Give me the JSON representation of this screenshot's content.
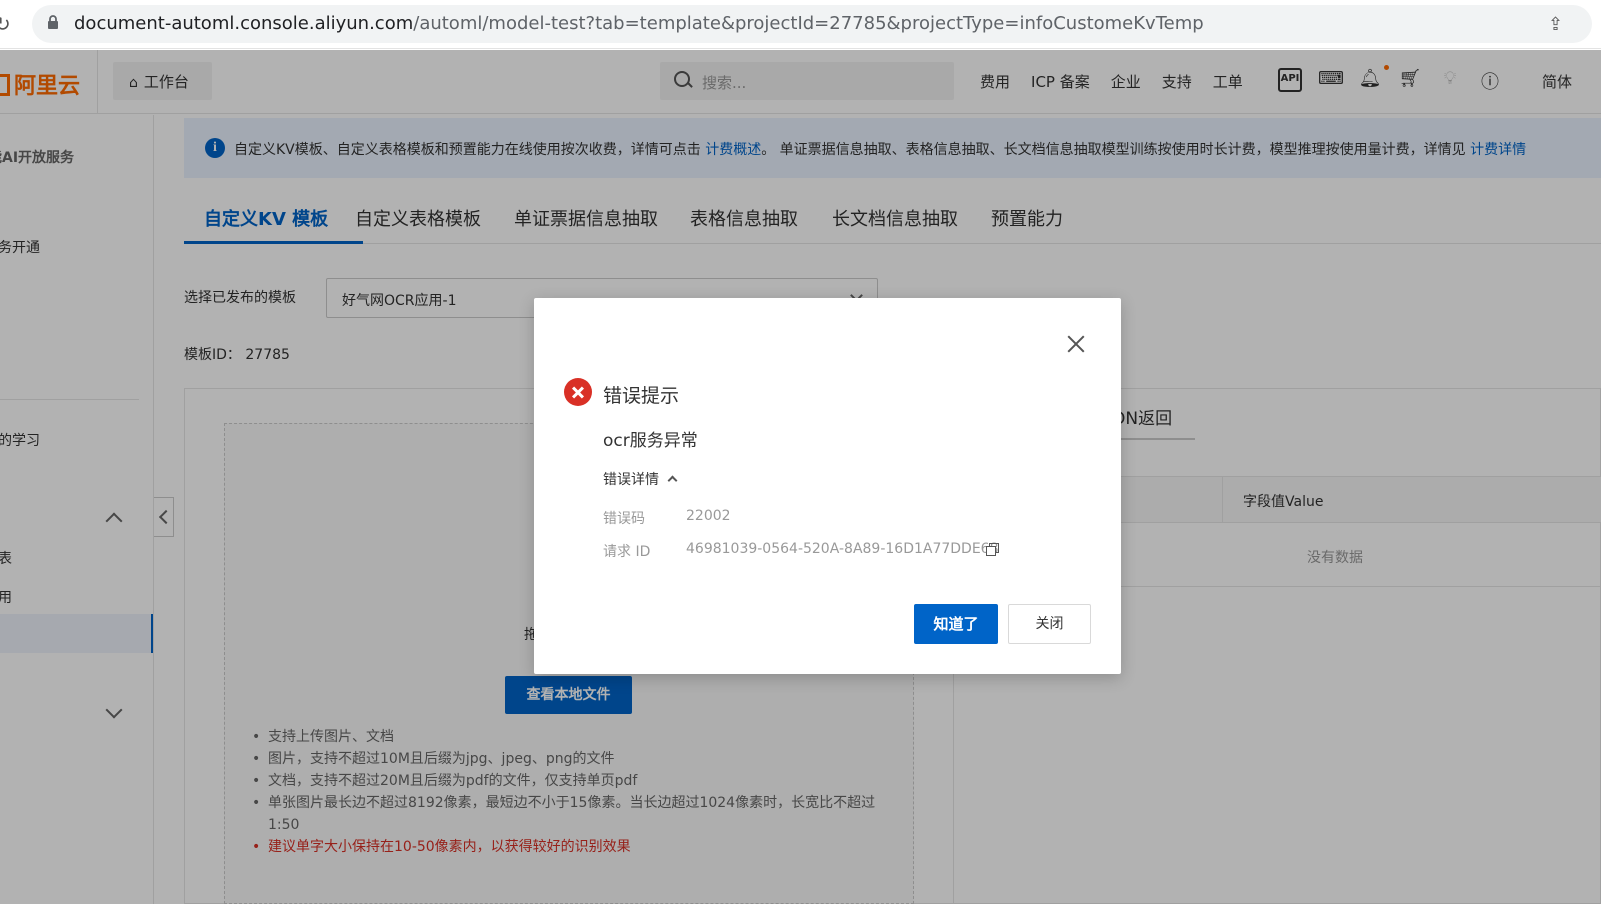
{
  "browser": {
    "url_host": "document-automl.console.aliyun.com",
    "url_path": "/automl/model-test?tab=template&projectId=27785&projectType=infoCustomeKvTemp"
  },
  "topnav": {
    "brand": "阿里云",
    "workbench": "工作台",
    "search_placeholder": "搜索...",
    "links": [
      "费用",
      "ICP 备案",
      "企业",
      "支持",
      "工单"
    ],
    "icons": [
      "api-icon",
      "terminal-icon",
      "bell-icon",
      "cart-icon",
      "lightbulb-icon",
      "help-icon"
    ],
    "api_glyph": "API",
    "lang": "简体"
  },
  "sidebar": {
    "title": "能AI开放服务",
    "item_activate": "务开通",
    "item_learn": "的学习",
    "item_list": "表",
    "item_app": "用"
  },
  "banner": {
    "text_before": "自定义KV模板、自定义表格模板和预置能力在线使用按次收费，详情可点击 ",
    "link1": "计费概述",
    "text_middle": "。 单证票据信息抽取、表格信息抽取、长文档信息抽取模型训练按使用时长计费，模型推理按使用量计费，详情见 ",
    "link2": "计费详情"
  },
  "tabs": [
    {
      "label": "自定义KV 模板"
    },
    {
      "label": "自定义表格模板"
    },
    {
      "label": "单证票据信息抽取"
    },
    {
      "label": "表格信息抽取"
    },
    {
      "label": "长文档信息抽取"
    },
    {
      "label": "预置能力"
    }
  ],
  "form": {
    "select_label": "选择已发布的模板",
    "select_value": "好气网OCR应用-1",
    "template_id_label": "模板ID：",
    "template_id": "27785"
  },
  "upload": {
    "drop_text_partial": "拖",
    "view_button": "查看本地文件",
    "tips": [
      "支持上传图片、文档",
      "图片，支持不超过10M且后缀为jpg、jpeg、png的文件",
      "文档，支持不超过20M且后缀为pdf的文件，仅支持单页pdf",
      "单张图片最长边不超过8192像素，最短边不小于15像素。当长边超过1024像素时，长宽比不超过1:50"
    ],
    "tip_warning": "建议单字大小保持在10-50像素内，以获得较好的识别效果"
  },
  "result": {
    "json_tab": "ON返回",
    "col_value": "字段值Value",
    "empty": "没有数据"
  },
  "modal": {
    "title": "错误提示",
    "message": "ocr服务异常",
    "details_toggle": "错误详情",
    "code_label": "错误码",
    "code_value": "22002",
    "request_label": "请求 ID",
    "request_value": "46981039-0564-520A-8A89-16D1A77DDE68",
    "ok_button": "知道了",
    "close_button": "关闭"
  },
  "colors": {
    "primary": "#0064c8",
    "brand": "#ff6a00",
    "error": "#d93026"
  }
}
